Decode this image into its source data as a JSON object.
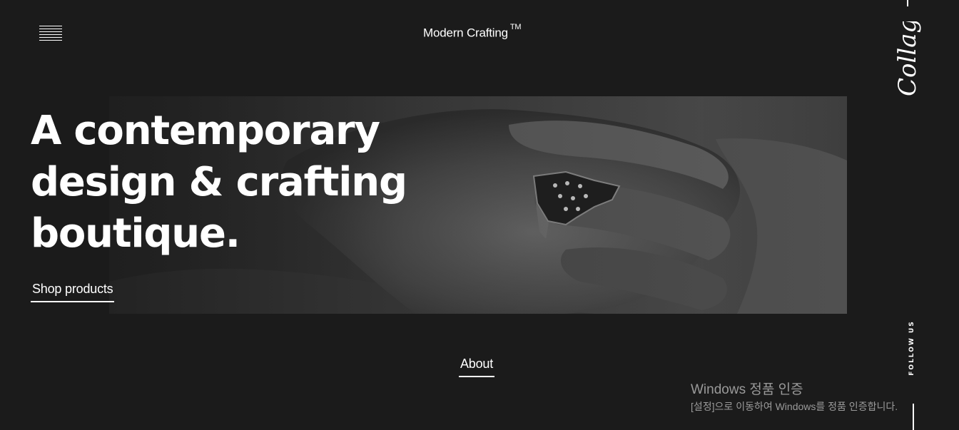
{
  "header": {
    "menu_icon": "hamburger-menu-icon",
    "brand_name": "Modern Crafting",
    "brand_mark": "TM"
  },
  "side": {
    "logo_text": "Collage",
    "follow_label": "FOLLOW US"
  },
  "hero": {
    "headline_lines": [
      "A contemporary",
      "design & crafting",
      "boutique."
    ],
    "cta_label": "Shop products",
    "image_subject": "hand-with-ring-photo"
  },
  "section": {
    "about_label": "About"
  },
  "watermark": {
    "title": "Windows 정품 인증",
    "subtitle": "[설정]으로 이동하여 Windows를 정품 인증합니다."
  },
  "colors": {
    "background": "#1b1b1b",
    "text": "#ffffff",
    "watermark": "#9a9a9a"
  }
}
